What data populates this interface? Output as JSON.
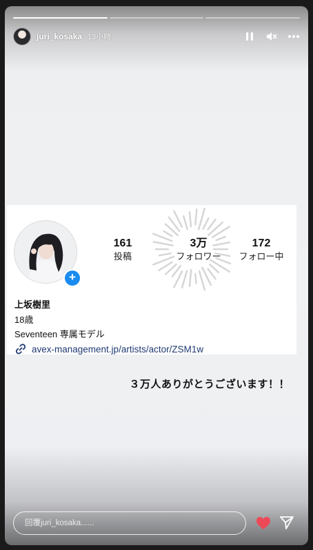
{
  "story": {
    "segments": [
      {
        "progress": 1.0
      },
      {
        "progress": 0.0
      },
      {
        "progress": 0.0
      }
    ],
    "username": "juri_kosaka",
    "timestamp": "13小時",
    "controls": {
      "pause_icon": "pause-icon",
      "mute_icon": "muted-speaker-icon",
      "more_icon": "more-dots-icon"
    }
  },
  "profile_card": {
    "stats": [
      {
        "value": "161",
        "label": "投稿"
      },
      {
        "value": "3万",
        "label": "フォロワー"
      },
      {
        "value": "172",
        "label": "フォロー中"
      }
    ],
    "name": "上坂樹里",
    "age": "18歳",
    "bio": "Seventeen 専属モデル",
    "link": "avex-management.jp/artists/actor/ZSM1w"
  },
  "caption": "３万人ありがとうございます！！",
  "reply": {
    "placeholder": "回覆juri_kosaka......"
  },
  "colors": {
    "accent_blue": "#1a8cf0",
    "heart_red": "#ed4956",
    "link_color": "#1f3a72"
  }
}
